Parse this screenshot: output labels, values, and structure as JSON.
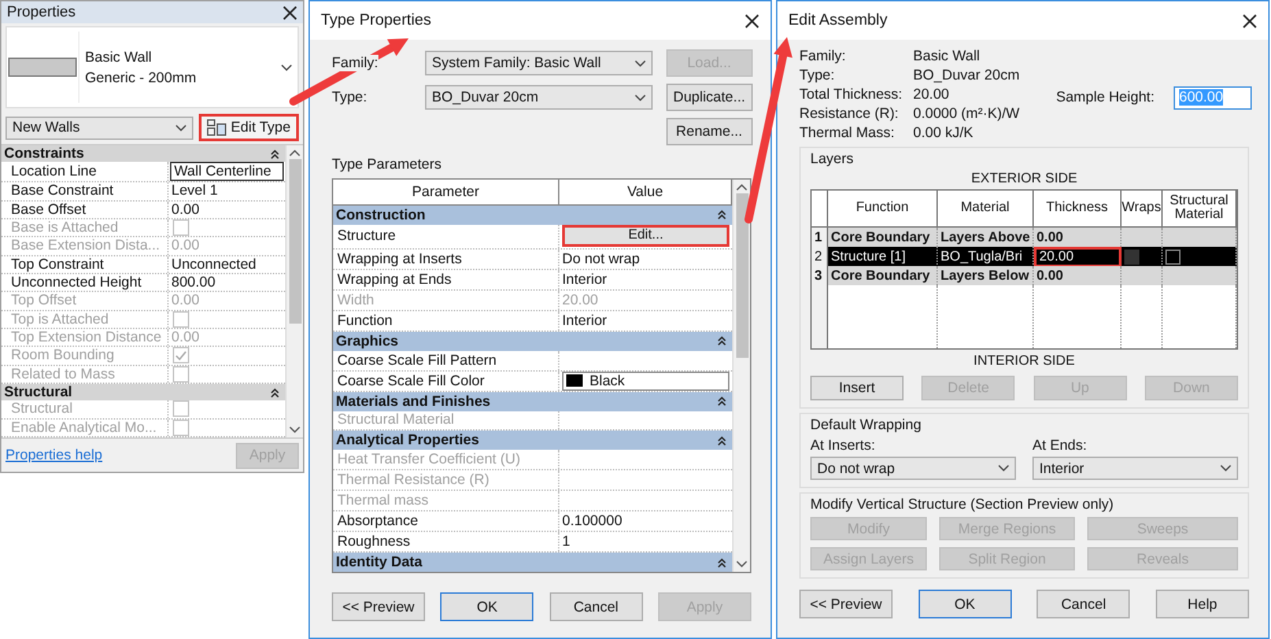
{
  "properties_panel": {
    "title": "Properties",
    "type_name": "Basic Wall",
    "type_subtype": "Generic - 200mm",
    "filter": "New Walls",
    "edit_type_button": {
      "label": "Edit Type",
      "highlighted": true
    },
    "groups": [
      {
        "name": "Constraints",
        "rows": [
          {
            "kind": "text_input",
            "label": "Location Line",
            "value": "Wall Centerline",
            "disabled": false
          },
          {
            "kind": "text",
            "label": "Base Constraint",
            "value": "Level 1",
            "disabled": false
          },
          {
            "kind": "text",
            "label": "Base Offset",
            "value": "0.00",
            "disabled": false
          },
          {
            "kind": "checkbox",
            "label": "Base is Attached",
            "checked": false,
            "disabled": true
          },
          {
            "kind": "text",
            "label": "Base Extension Dista...",
            "value": "0.00",
            "disabled": true
          },
          {
            "kind": "text",
            "label": "Top Constraint",
            "value": "Unconnected",
            "disabled": false
          },
          {
            "kind": "text",
            "label": "Unconnected Height",
            "value": "800.00",
            "disabled": false
          },
          {
            "kind": "text",
            "label": "Top Offset",
            "value": "0.00",
            "disabled": true
          },
          {
            "kind": "checkbox",
            "label": "Top is Attached",
            "checked": false,
            "disabled": true
          },
          {
            "kind": "text",
            "label": "Top Extension Distance",
            "value": "0.00",
            "disabled": true
          },
          {
            "kind": "checkbox",
            "label": "Room Bounding",
            "checked": true,
            "disabled": true
          },
          {
            "kind": "checkbox",
            "label": "Related to Mass",
            "checked": false,
            "disabled": true
          }
        ]
      },
      {
        "name": "Structural",
        "rows": [
          {
            "kind": "checkbox",
            "label": "Structural",
            "checked": false,
            "disabled": true
          },
          {
            "kind": "checkbox",
            "label": "Enable Analytical Mo...",
            "checked": false,
            "disabled": true
          }
        ]
      }
    ],
    "help_link": "Properties help",
    "apply_button": {
      "label": "Apply",
      "disabled": true
    }
  },
  "type_properties": {
    "title": "Type Properties",
    "fields": [
      {
        "label": "Family:",
        "value": "System Family: Basic Wall"
      },
      {
        "label": "Type:",
        "value": "BO_Duvar 20cm"
      }
    ],
    "side_buttons": [
      {
        "label": "Load...",
        "disabled": true
      },
      {
        "label": "Duplicate...",
        "disabled": false
      },
      {
        "label": "Rename...",
        "disabled": false
      }
    ],
    "section_label": "Type Parameters",
    "columns": [
      "Parameter",
      "Value"
    ],
    "groups": [
      {
        "name": "Construction",
        "rows": [
          {
            "kind": "button",
            "label": "Structure",
            "value": "Edit...",
            "disabled": false,
            "highlighted": true
          },
          {
            "kind": "text",
            "label": "Wrapping at Inserts",
            "value": "Do not wrap",
            "disabled": false
          },
          {
            "kind": "text",
            "label": "Wrapping at Ends",
            "value": "Interior",
            "disabled": false
          },
          {
            "kind": "text",
            "label": "Width",
            "value": "20.00",
            "disabled": true
          },
          {
            "kind": "text",
            "label": "Function",
            "value": "Interior",
            "disabled": false
          }
        ]
      },
      {
        "name": "Graphics",
        "rows": [
          {
            "kind": "text",
            "label": "Coarse Scale Fill Pattern",
            "disabled": false
          },
          {
            "kind": "swatch",
            "label": "Coarse Scale Fill Color",
            "value": "Black",
            "disabled": false
          }
        ]
      },
      {
        "name": "Materials and Finishes",
        "rows": [
          {
            "kind": "text",
            "label": "Structural Material",
            "disabled": true
          }
        ]
      },
      {
        "name": "Analytical Properties",
        "rows": [
          {
            "kind": "text",
            "label": "Heat Transfer Coefficient (U)",
            "disabled": true
          },
          {
            "kind": "text",
            "label": "Thermal Resistance (R)",
            "disabled": true
          },
          {
            "kind": "text",
            "label": "Thermal mass",
            "disabled": true
          },
          {
            "kind": "text",
            "label": "Absorptance",
            "value": "0.100000",
            "disabled": false
          },
          {
            "kind": "text",
            "label": "Roughness",
            "value": "1",
            "disabled": false
          }
        ]
      },
      {
        "name": "Identity Data"
      }
    ],
    "footer_buttons": [
      {
        "label": "<< Preview",
        "disabled": false,
        "default": false
      },
      {
        "label": "OK",
        "disabled": false,
        "default": true
      },
      {
        "label": "Cancel",
        "disabled": false,
        "default": false
      },
      {
        "label": "Apply",
        "disabled": true,
        "default": false
      }
    ]
  },
  "edit_assembly": {
    "title": "Edit Assembly",
    "info": [
      {
        "label": "Family:",
        "value": "Basic Wall"
      },
      {
        "label": "Type:",
        "value": "BO_Duvar 20cm"
      },
      {
        "label": "Total Thickness:",
        "value": "20.00"
      },
      {
        "label": "Resistance (R):",
        "value": "0.0000 (m²·K)/W"
      },
      {
        "label": "Thermal Mass:",
        "value": "0.00 kJ/K"
      }
    ],
    "sample_height": {
      "label": "Sample Height:",
      "value": "600.00"
    },
    "layers": {
      "title": "Layers",
      "top_label": "EXTERIOR SIDE",
      "bottom_label": "INTERIOR SIDE",
      "columns": [
        "Function",
        "Material",
        "Thickness",
        "Wraps",
        "Structural Material"
      ],
      "rows": [
        {
          "kind": "boundary",
          "number": "1",
          "function": "Core Boundary",
          "material": "Layers Above",
          "thickness": "0.00",
          "selected": false
        },
        {
          "kind": "layer",
          "number": "2",
          "function": "Structure [1]",
          "material": "BO_Tugla/Bri",
          "thickness": "20.00",
          "selected": true,
          "thickness_highlighted": true,
          "wraps": false,
          "structural_material": false
        },
        {
          "kind": "boundary",
          "number": "3",
          "function": "Core Boundary",
          "material": "Layers Below",
          "thickness": "0.00",
          "selected": false
        }
      ],
      "buttons": [
        {
          "label": "Insert",
          "disabled": false
        },
        {
          "label": "Delete",
          "disabled": true
        },
        {
          "label": "Up",
          "disabled": true
        },
        {
          "label": "Down",
          "disabled": true
        }
      ]
    },
    "default_wrapping": {
      "title": "Default Wrapping",
      "fields": [
        {
          "label": "At Inserts:",
          "value": "Do not wrap"
        },
        {
          "label": "At Ends:",
          "value": "Interior"
        }
      ]
    },
    "modify_structure": {
      "title": "Modify Vertical Structure (Section Preview only)",
      "buttons": [
        {
          "label": "Modify",
          "disabled": true
        },
        {
          "label": "Merge Regions",
          "disabled": true
        },
        {
          "label": "Sweeps",
          "disabled": true
        },
        {
          "label": "Assign Layers",
          "disabled": true
        },
        {
          "label": "Split Region",
          "disabled": true
        },
        {
          "label": "Reveals",
          "disabled": true
        }
      ]
    },
    "footer_buttons": [
      {
        "label": "<< Preview",
        "disabled": false,
        "default": false
      },
      {
        "label": "OK",
        "disabled": false,
        "default": true
      },
      {
        "label": "Cancel",
        "disabled": false,
        "default": false
      },
      {
        "label": "Help",
        "disabled": false,
        "default": false
      }
    ]
  }
}
